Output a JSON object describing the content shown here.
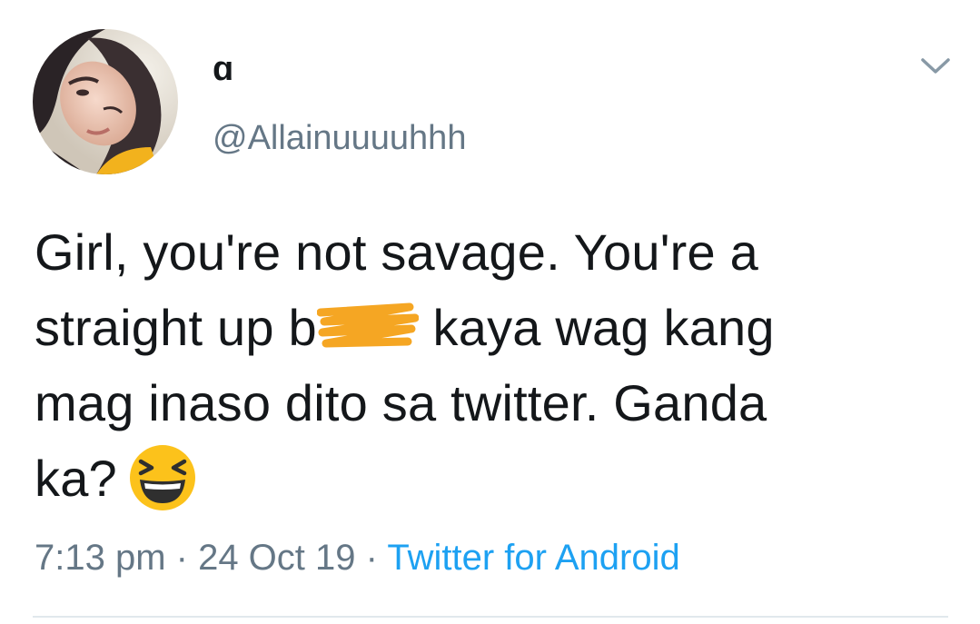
{
  "user": {
    "display_name": "ɑ",
    "handle": "@Allainuuuuhhh"
  },
  "tweet": {
    "lines": [
      "Girl, you're not savage. You're a",
      "straight up b",
      " kaya wag kang",
      "mag inaso dito sa twitter. Ganda",
      "ka?"
    ],
    "emoji_icon": "grinning-squinting-face-icon",
    "redaction_color": "#f5a623"
  },
  "meta": {
    "time": "7:13 pm",
    "separator": " · ",
    "date": "24 Oct 19",
    "source": "Twitter for Android"
  },
  "colors": {
    "text": "#14171a",
    "secondary": "#657786",
    "link": "#1da1f2",
    "divider": "#e1e8ed"
  },
  "icons": {
    "menu": "chevron-down-icon",
    "avatar": "avatar"
  }
}
